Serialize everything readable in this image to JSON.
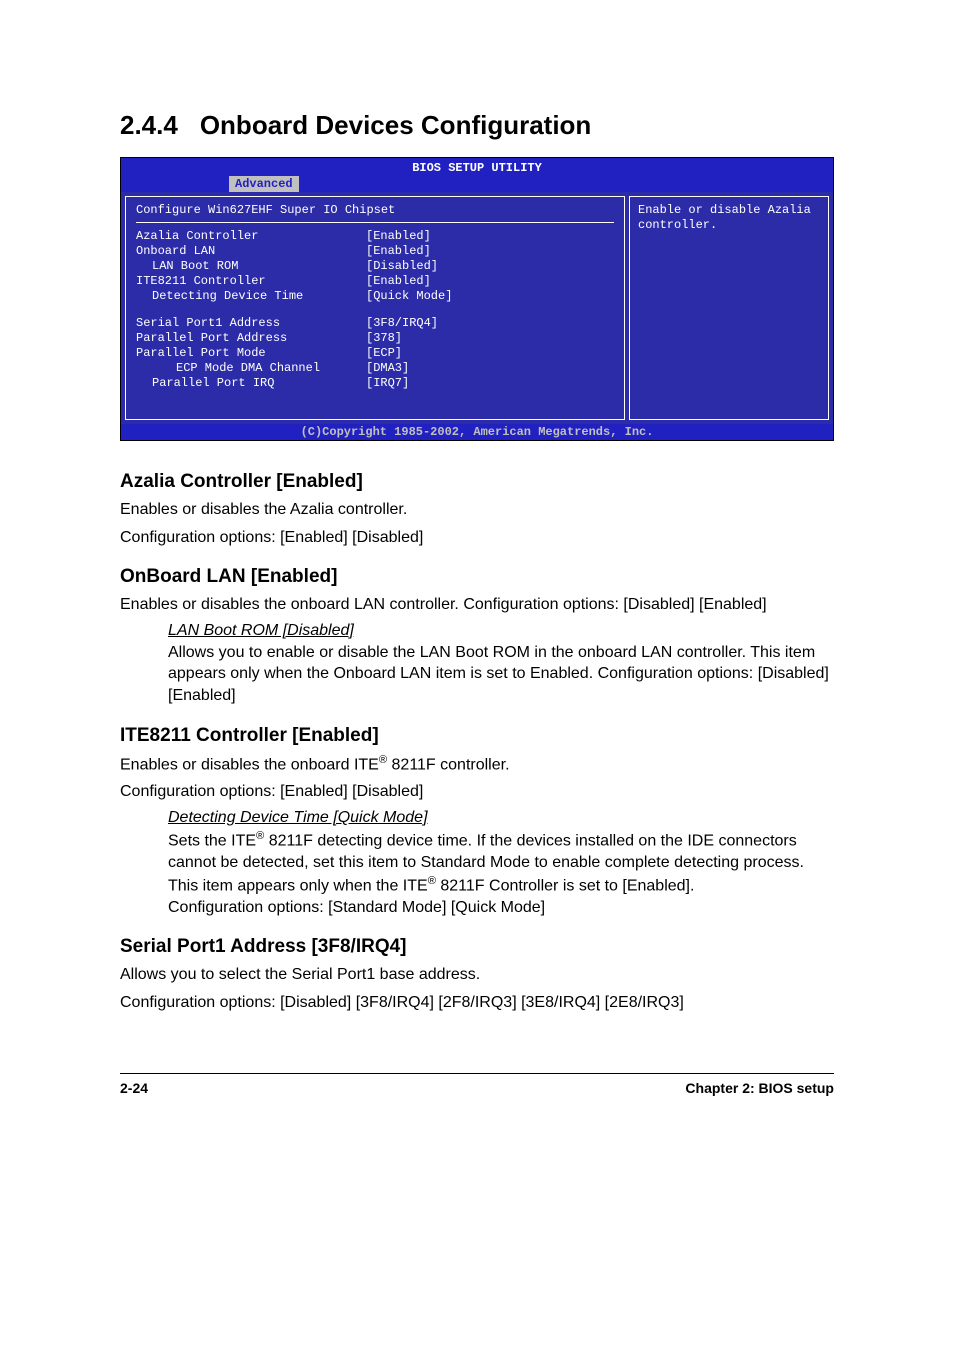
{
  "section": {
    "number": "2.4.4",
    "title": "Onboard Devices Configuration"
  },
  "bios": {
    "title": "BIOS SETUP UTILITY",
    "tab": "Advanced",
    "chipset_title": "Configure Win627EHF Super IO Chipset",
    "rows_a": [
      {
        "label": "Azalia Controller",
        "value": "[Enabled]",
        "indent": 0
      },
      {
        "label": "Onboard LAN",
        "value": "[Enabled]",
        "indent": 0
      },
      {
        "label": "LAN Boot ROM",
        "value": "[Disabled]",
        "indent": 1
      },
      {
        "label": "ITE8211 Controller",
        "value": "[Enabled]",
        "indent": 0
      },
      {
        "label": "Detecting Device Time",
        "value": "[Quick Mode]",
        "indent": 1
      }
    ],
    "rows_b": [
      {
        "label": "Serial Port1 Address",
        "value": "[3F8/IRQ4]",
        "indent": 0
      },
      {
        "label": "Parallel Port Address",
        "value": "[378]",
        "indent": 0
      },
      {
        "label": "Parallel Port Mode",
        "value": "[ECP]",
        "indent": 0
      },
      {
        "label": "ECP Mode DMA Channel",
        "value": "[DMA3]",
        "indent": 2
      },
      {
        "label": "Parallel Port IRQ",
        "value": "[IRQ7]",
        "indent": 1
      }
    ],
    "help": "Enable or disable Azalia controller.",
    "footer": "(C)Copyright 1985-2002, American Megatrends, Inc."
  },
  "azalia": {
    "heading": "Azalia Controller [Enabled]",
    "p1": "Enables or disables the Azalia controller.",
    "p2": "Configuration options: [Enabled] [Disabled]"
  },
  "onboard_lan": {
    "heading": "OnBoard LAN [Enabled]",
    "p1": "Enables or disables the onboard LAN controller.  Configuration options: [Disabled] [Enabled]",
    "sub_title": "LAN Boot ROM [Disabled]",
    "sub_body": "Allows you to enable or disable the LAN Boot ROM in the onboard LAN controller. This item appears only when the Onboard LAN item is set to Enabled. Configuration options: [Disabled] [Enabled]"
  },
  "ite": {
    "heading": "ITE8211 Controller [Enabled]",
    "p1_pre": "Enables or disables the onboard ITE",
    "p1_post": " 8211F controller.",
    "p2": "Configuration options: [Enabled] [Disabled]",
    "sub_title": "Detecting Device Time [Quick Mode]",
    "sub_body_pre1": "Sets the ITE",
    "sub_body_mid1": " 8211F detecting device time. If the devices installed on the IDE connectors cannot be detected, set this item to Standard Mode to enable complete detecting process. This item appears only when the ITE",
    "sub_body_post": " 8211F Controller is set to [Enabled].",
    "sub_body_cfg": "Configuration options: [Standard Mode] [Quick Mode]"
  },
  "serial": {
    "heading": "Serial Port1 Address [3F8/IRQ4]",
    "p1": "Allows you to select the Serial Port1 base address.",
    "p2": "Configuration options: [Disabled] [3F8/IRQ4] [2F8/IRQ3] [3E8/IRQ4] [2E8/IRQ3]"
  },
  "footer": {
    "left": "2-24",
    "right": "Chapter 2: BIOS setup"
  },
  "reg": "®"
}
